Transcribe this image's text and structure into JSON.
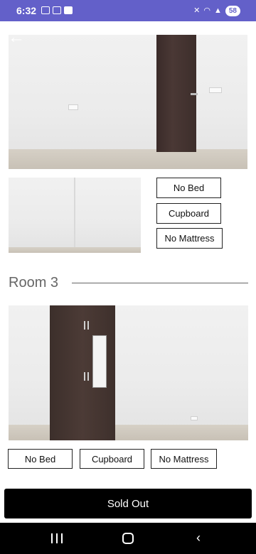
{
  "status_bar": {
    "time": "6:32",
    "battery": "58",
    "icons": [
      "notification-icon",
      "screenshot-icon",
      "message-icon",
      "mute-icon",
      "wifi-icon",
      "signal-icon",
      "battery-icon"
    ]
  },
  "back_icon": "back-arrow-icon",
  "room2": {
    "amenities": [
      "No Bed",
      "Cupboard",
      "No Mattress"
    ]
  },
  "room3": {
    "title": "Room 3",
    "amenities": [
      "No Bed",
      "Cupboard",
      "No Mattress"
    ]
  },
  "action": {
    "sold_out_label": "Sold Out"
  },
  "nav": {
    "icons": [
      "recents-icon",
      "home-icon",
      "back-icon"
    ]
  }
}
